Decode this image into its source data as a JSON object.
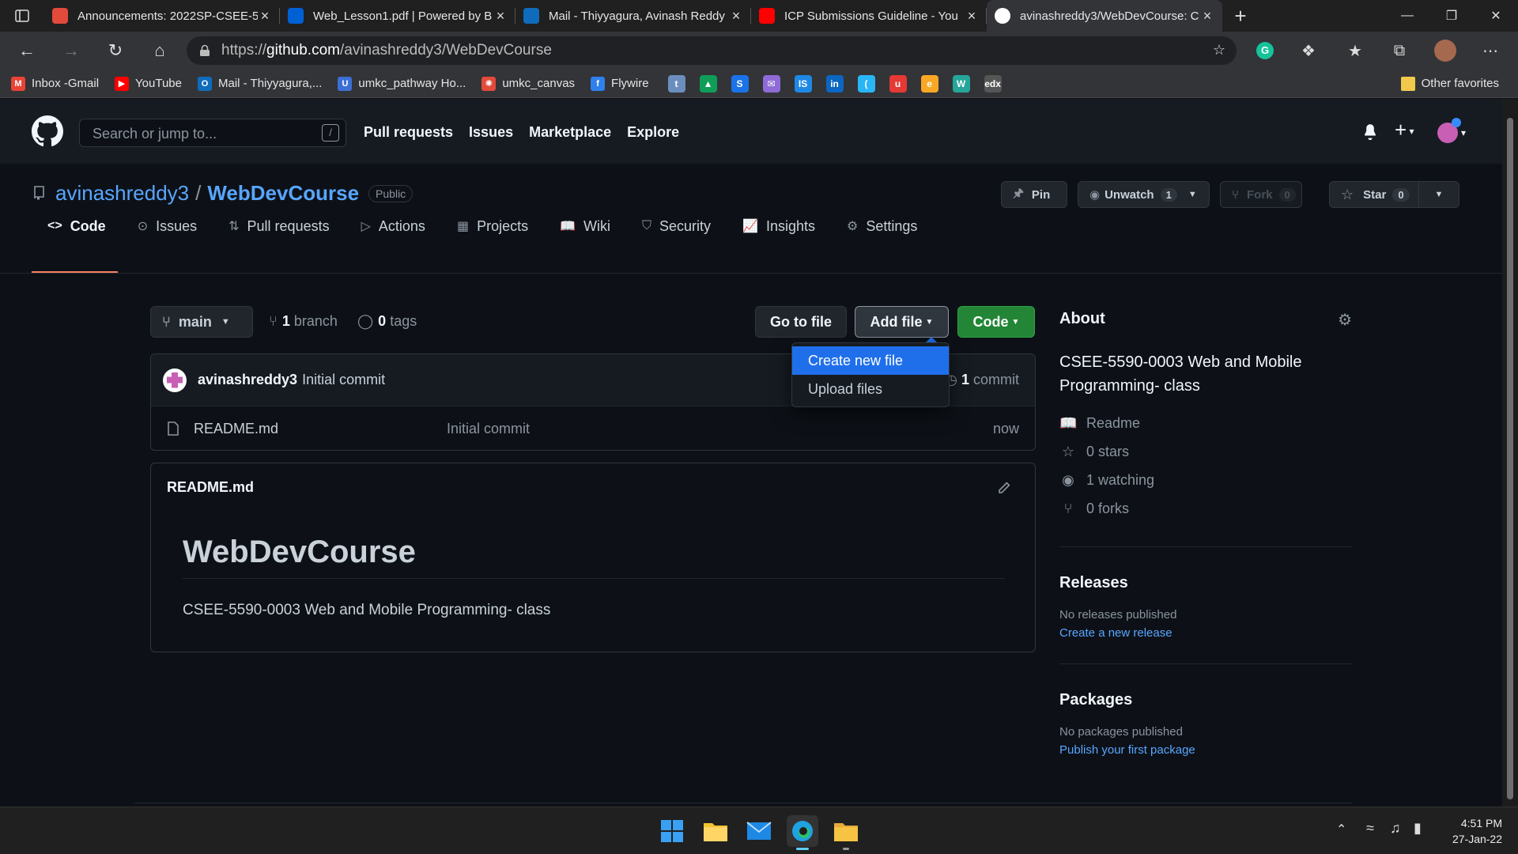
{
  "browser": {
    "tabs": [
      {
        "title": "Announcements: 2022SP-CSEE-5",
        "icon": "canvas-icon",
        "color": "#e24a3b",
        "active": false
      },
      {
        "title": "Web_Lesson1.pdf | Powered by B",
        "icon": "box-icon",
        "color": "#0061d5",
        "active": false
      },
      {
        "title": "Mail - Thiyyagura, Avinash Reddy",
        "icon": "outlook-icon",
        "color": "#0f6cbd",
        "active": false
      },
      {
        "title": "ICP Submissions Guideline - You",
        "icon": "youtube-icon",
        "color": "#ff0000",
        "active": false
      },
      {
        "title": "avinashreddy3/WebDevCourse: C",
        "icon": "github-icon",
        "color": "#ffffff",
        "active": true
      }
    ],
    "new_tab": "+",
    "url_prefix": "https://",
    "url_host": "github.com",
    "url_path": "/avinashreddy3/WebDevCourse",
    "bookmarks": [
      {
        "label": "Inbox -Gmail",
        "color": "#ea4335",
        "glyph": "M"
      },
      {
        "label": "YouTube",
        "color": "#ff0000",
        "glyph": "▶"
      },
      {
        "label": "Mail - Thiyyagura,...",
        "color": "#0f6cbd",
        "glyph": "O"
      },
      {
        "label": "umkc_pathway Ho...",
        "color": "#3c6fd6",
        "glyph": "U"
      },
      {
        "label": "umkc_canvas",
        "color": "#e24a3b",
        "glyph": "✺"
      },
      {
        "label": "Flywire",
        "color": "#2f80ed",
        "glyph": "f"
      }
    ],
    "bookmark_icons": [
      {
        "color": "#6c8ebf",
        "glyph": "t"
      },
      {
        "color": "#0f9d58",
        "glyph": "▲"
      },
      {
        "color": "#1a73e8",
        "glyph": "S"
      },
      {
        "color": "#8e6bd6",
        "glyph": "✉"
      },
      {
        "color": "#1e88e5",
        "glyph": "IS"
      },
      {
        "color": "#0a66c2",
        "glyph": "in"
      },
      {
        "color": "#29b6f6",
        "glyph": "("
      },
      {
        "color": "#e53935",
        "glyph": "u"
      },
      {
        "color": "#f9a825",
        "glyph": "e"
      },
      {
        "color": "#26a69a",
        "glyph": "W"
      },
      {
        "color": "#555555",
        "glyph": "edx"
      }
    ],
    "other_favorites": "Other favorites"
  },
  "github": {
    "search_placeholder": "Search or jump to...",
    "slash_key": "/",
    "nav": [
      "Pull requests",
      "Issues",
      "Marketplace",
      "Explore"
    ],
    "owner": "avinashreddy3",
    "separator": "/",
    "repo": "WebDevCourse",
    "visibility": "Public",
    "pin_label": "Pin",
    "unwatch_label": "Unwatch",
    "unwatch_count": "1",
    "fork_label": "Fork",
    "fork_count": "0",
    "star_label": "Star",
    "star_count": "0",
    "tabs": [
      {
        "label": "Code",
        "icon": "code-icon",
        "glyph": "<>"
      },
      {
        "label": "Issues",
        "icon": "issues-icon",
        "glyph": "⊙"
      },
      {
        "label": "Pull requests",
        "icon": "pull-request-icon",
        "glyph": "⇅"
      },
      {
        "label": "Actions",
        "icon": "actions-icon",
        "glyph": "▷"
      },
      {
        "label": "Projects",
        "icon": "projects-icon",
        "glyph": "▦"
      },
      {
        "label": "Wiki",
        "icon": "wiki-icon",
        "glyph": "📖"
      },
      {
        "label": "Security",
        "icon": "shield-icon",
        "glyph": "⛉"
      },
      {
        "label": "Insights",
        "icon": "graph-icon",
        "glyph": "📈"
      },
      {
        "label": "Settings",
        "icon": "gear-icon",
        "glyph": "⚙"
      }
    ],
    "branch_name": "main",
    "branch_count": "1",
    "branch_word": "branch",
    "tag_count": "0",
    "tag_word": "tags",
    "go_to_file": "Go to file",
    "add_file": "Add file",
    "code_button": "Code",
    "dropdown": [
      "Create new file",
      "Upload files"
    ],
    "commit_author": "avinashreddy3",
    "commit_message": "Initial commit",
    "commit_count": "1",
    "commit_word": "commit",
    "files": [
      {
        "name": "README.md",
        "message": "Initial commit",
        "age": "now"
      }
    ],
    "readme_title": "README.md",
    "readme_h1": "WebDevCourse",
    "readme_body": "CSEE-5590-0003 Web and Mobile Programming- class",
    "about_title": "About",
    "about_desc": "CSEE-5590-0003 Web and Mobile Programming- class",
    "about_items": [
      {
        "label": "Readme",
        "icon": "book-icon",
        "glyph": "📖"
      },
      {
        "label": "0 stars",
        "icon": "star-icon",
        "glyph": "☆"
      },
      {
        "label": "1 watching",
        "icon": "eye-icon",
        "glyph": "◉"
      },
      {
        "label": "0 forks",
        "icon": "fork-icon",
        "glyph": "⑂"
      }
    ],
    "releases_title": "Releases",
    "releases_empty": "No releases published",
    "releases_link": "Create a new release",
    "packages_title": "Packages",
    "packages_empty": "No packages published",
    "packages_link": "Publish your first package"
  },
  "taskbar": {
    "time": "4:51 PM",
    "date": "27-Jan-22"
  },
  "colors": {
    "link": "#58a6ff",
    "green": "#238636",
    "accent_underline": "#f78166",
    "dropdown_highlight": "#1f6feb"
  }
}
